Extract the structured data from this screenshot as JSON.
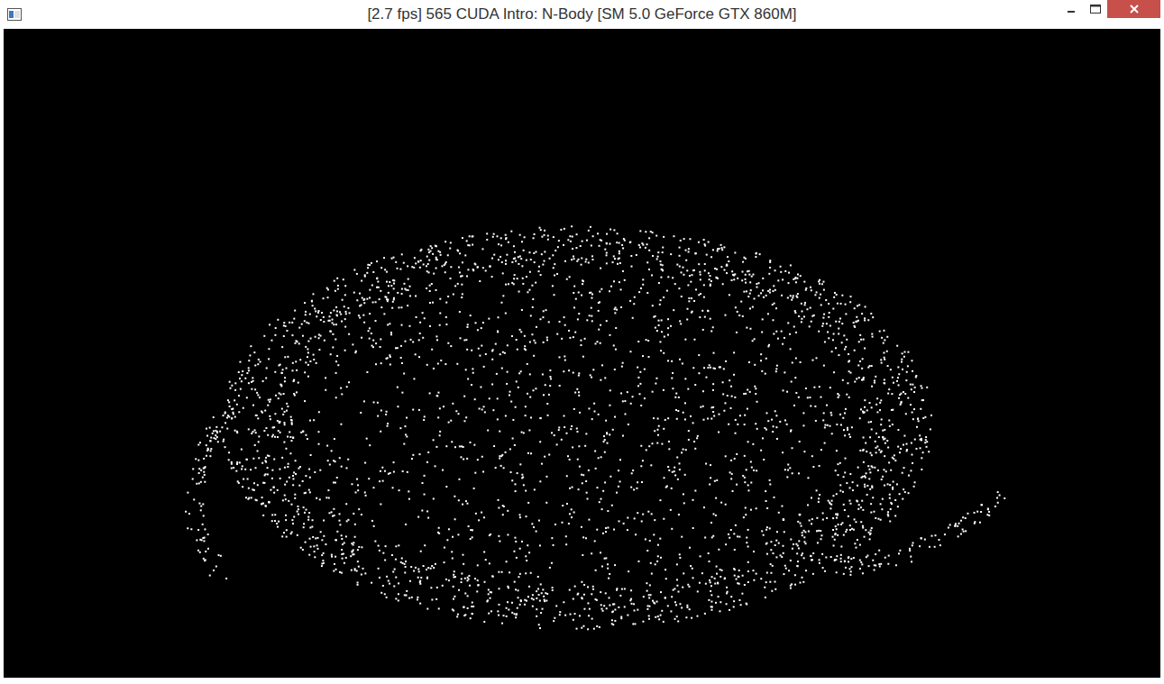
{
  "window": {
    "title": "[2.7 fps] 565 CUDA Intro: N-Body [SM 5.0 GeForce GTX 860M]"
  }
}
